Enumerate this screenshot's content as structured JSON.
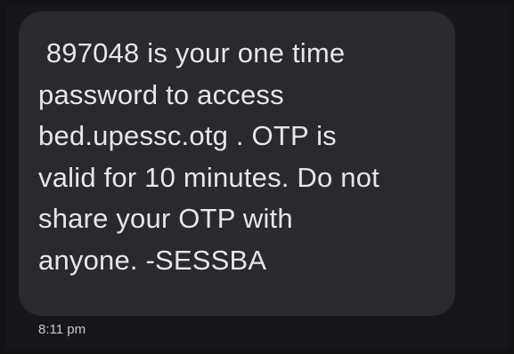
{
  "conversation": {
    "message_bubble": {
      "text": " 897048 is your one time\npassword to access\nbed.upessc.otg . OTP is\nvalid for 10 minutes. Do not\nshare your OTP with\nanyone. -SESSBA"
    },
    "timestamp": "8:11 pm"
  }
}
